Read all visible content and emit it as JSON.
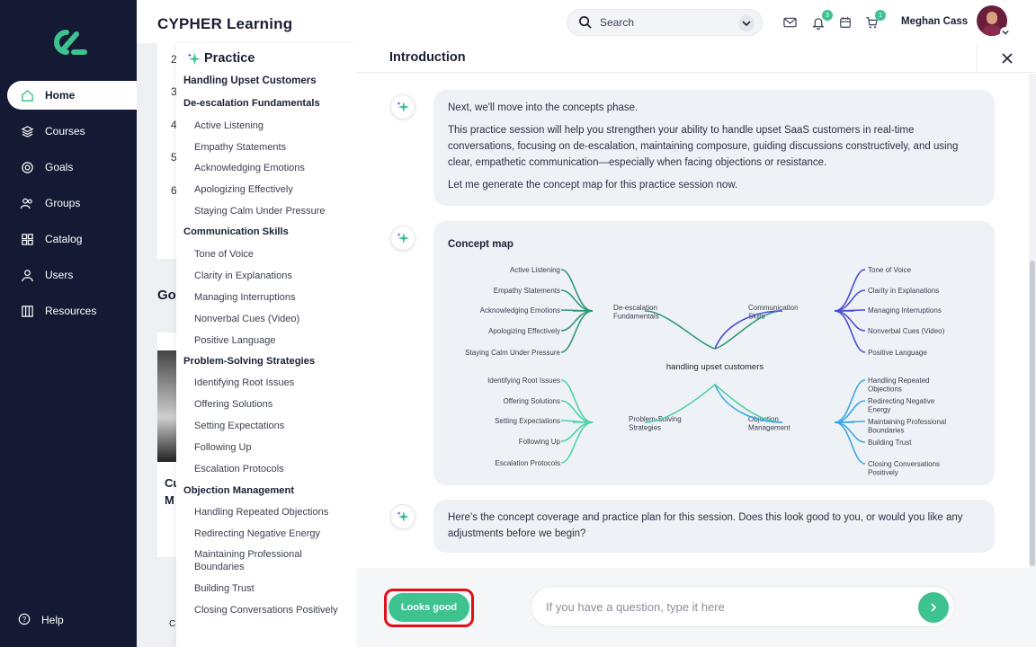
{
  "nav": {
    "items": [
      {
        "label": "Home",
        "icon": "home-icon",
        "active": true
      },
      {
        "label": "Courses",
        "icon": "courses-icon"
      },
      {
        "label": "Goals",
        "icon": "goals-icon"
      },
      {
        "label": "Groups",
        "icon": "groups-icon"
      },
      {
        "label": "Catalog",
        "icon": "catalog-icon"
      },
      {
        "label": "Users",
        "icon": "users-icon"
      },
      {
        "label": "Resources",
        "icon": "resources-icon"
      }
    ],
    "help": "Help"
  },
  "header": {
    "brand": "CYPHER Learning",
    "search_placeholder": "Search",
    "notifications_count": "3",
    "cart_count": "1",
    "user_name": "Meghan Cass"
  },
  "background": {
    "row_numbers": [
      "2",
      "3",
      "4",
      "5",
      "6"
    ],
    "section_fragment": "Go",
    "card_fragment_1": "Cu",
    "card_fragment_2": "M",
    "footer_fragment": "C"
  },
  "practice": {
    "title": "Practice",
    "root": "Handling Upset Customers",
    "sections": [
      {
        "title": "De-escalation Fundamentals",
        "items": [
          "Active Listening",
          "Empathy Statements",
          "Acknowledging Emotions",
          "Apologizing Effectively",
          "Staying Calm Under Pressure"
        ]
      },
      {
        "title": "Communication Skills",
        "items": [
          "Tone of Voice",
          "Clarity in Explanations",
          "Managing Interruptions",
          "Nonverbal Cues (Video)",
          "Positive Language"
        ]
      },
      {
        "title": "Problem-Solving Strategies",
        "items": [
          "Identifying Root Issues",
          "Offering Solutions",
          "Setting Expectations",
          "Following Up",
          "Escalation Protocols"
        ]
      },
      {
        "title": "Objection Management",
        "items": [
          "Handling Repeated Objections",
          "Redirecting Negative Energy",
          "Maintaining Professional Boundaries",
          "Building Trust",
          "Closing Conversations Positively"
        ]
      }
    ]
  },
  "chat": {
    "title": "Introduction",
    "messages": [
      {
        "paragraphs": [
          "Next, we'll move into the concepts phase.",
          "This practice session will help you strengthen your ability to handle upset SaaS customers in real-time conversations, focusing on de-escalation, maintaining composure, guiding discussions constructively, and using clear, empathetic communication—especially when facing objections or resistance.",
          "Let me generate the concept map for this practice session now."
        ]
      },
      {
        "paragraphs": [
          "Here’s the concept coverage and practice plan for this session. Does this look good to you, or would you like any adjustments before we begin?"
        ]
      }
    ],
    "concept_map": {
      "title": "Concept map",
      "center": "handling upset customers",
      "branches": [
        {
          "label": "De-escalation Fundamentals",
          "color": "#2e9a78",
          "leaves": [
            "Active Listening",
            "Empathy Statements",
            "Acknowledging Emotions",
            "Apologizing Effectively",
            "Staying Calm Under Pressure"
          ]
        },
        {
          "label": "Communication Skills",
          "color": "#4a4fd1",
          "leaves": [
            "Tone of Voice",
            "Clarity in Explanations",
            "Managing Interruptions",
            "Nonverbal Cues (Video)",
            "Positive Language"
          ]
        },
        {
          "label": "Problem-Solving Strategies",
          "color": "#4fd3a8",
          "leaves": [
            "Identifying Root Issues",
            "Offering Solutions",
            "Setting Expectations",
            "Following Up",
            "Escalation Protocols"
          ]
        },
        {
          "label": "Objection Management",
          "color": "#3aa9e0",
          "leaves": [
            "Handling Repeated Objections",
            "Redirecting Negative Energy",
            "Maintaining Professional Boundaries",
            "Building Trust",
            "Closing Conversations Positively"
          ]
        }
      ]
    },
    "confirm_label": "Looks good",
    "input_placeholder": "If you have a question, type it here"
  },
  "colors": {
    "accent": "#3ec28f",
    "nav_bg": "#141a33",
    "highlight": "#e0101a"
  }
}
